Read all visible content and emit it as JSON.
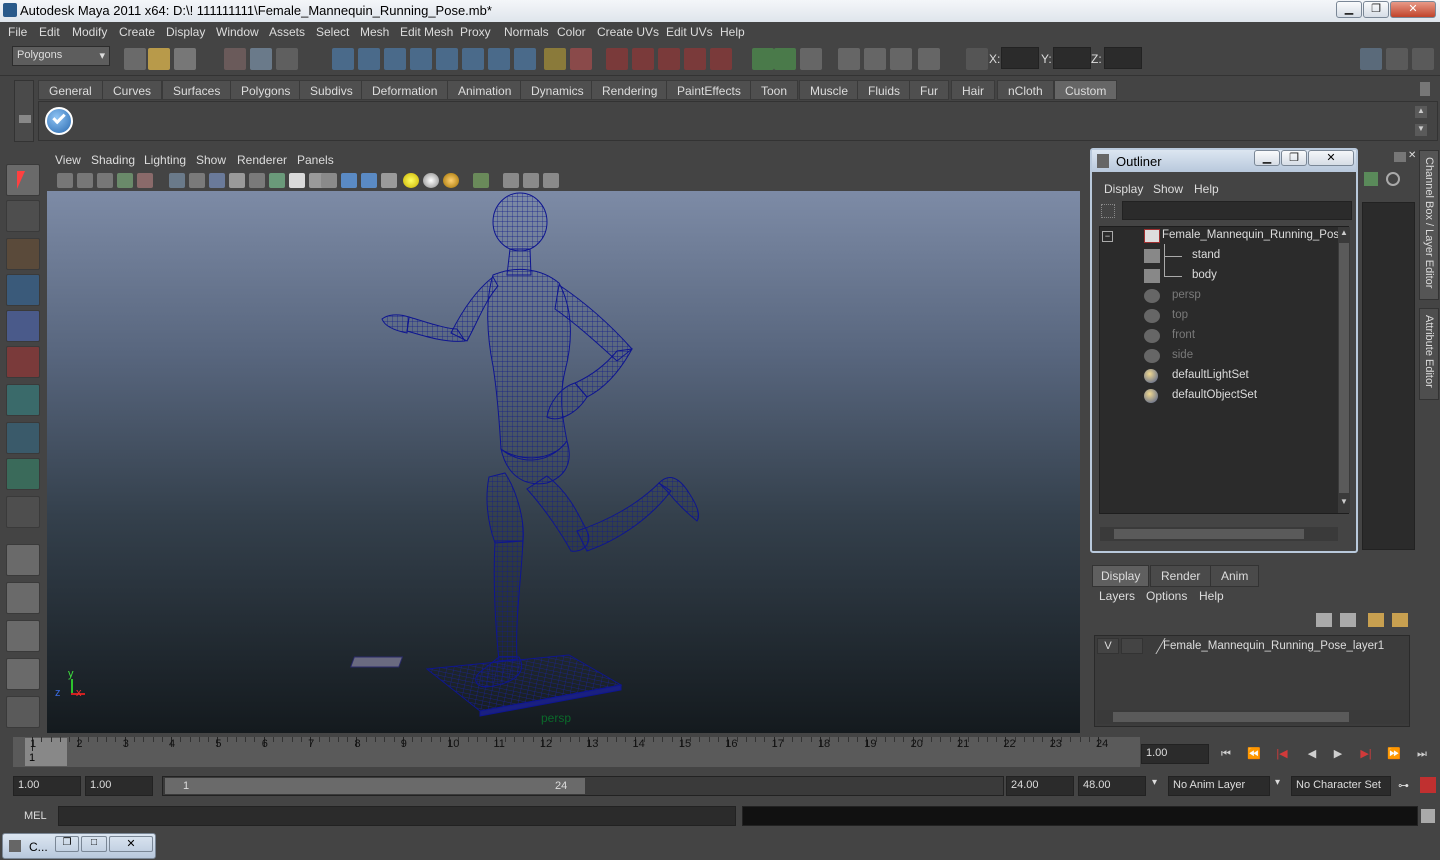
{
  "window": {
    "title": "Autodesk Maya 2011 x64: D:\\! 111111111\\Female_Mannequin_Running_Pose.mb*"
  },
  "menubar": [
    "File",
    "Edit",
    "Modify",
    "Create",
    "Display",
    "Window",
    "Assets",
    "Select",
    "Mesh",
    "Edit Mesh",
    "Proxy",
    "Normals",
    "Color",
    "Create UVs",
    "Edit UVs",
    "Help"
  ],
  "toolbar": {
    "mode": "Polygons",
    "x_label": "X:",
    "y_label": "Y:",
    "z_label": "Z:"
  },
  "shelf_tabs": [
    "General",
    "Curves",
    "Surfaces",
    "Polygons",
    "Subdivs",
    "Deformation",
    "Animation",
    "Dynamics",
    "Rendering",
    "PaintEffects",
    "Toon",
    "Muscle",
    "Fluids",
    "Fur",
    "Hair",
    "nCloth",
    "Custom"
  ],
  "shelf_active": "Custom",
  "viewport": {
    "menus": [
      "View",
      "Shading",
      "Lighting",
      "Show",
      "Renderer",
      "Panels"
    ],
    "camera_label": "persp",
    "axis_y": "y",
    "axis_z": "z",
    "axis_x": "x"
  },
  "outliner": {
    "title": "Outliner",
    "menus": [
      "Display",
      "Show",
      "Help"
    ],
    "expand_symbol": "−",
    "items": [
      "Female_Mannequin_Running_Pose",
      "stand",
      "body",
      "persp",
      "top",
      "front",
      "side",
      "defaultLightSet",
      "defaultObjectSet"
    ]
  },
  "side_tabs": {
    "channel_box": "Channel Box / Layer Editor",
    "attribute_editor": "Attribute Editor"
  },
  "layer_editor": {
    "tabs": [
      "Display",
      "Render",
      "Anim"
    ],
    "menus": [
      "Layers",
      "Options",
      "Help"
    ],
    "layer_visibility": "V",
    "layer_name": "Female_Mannequin_Running_Pose_layer1"
  },
  "timeline": {
    "ticks": [
      "1",
      "2",
      "3",
      "4",
      "5",
      "6",
      "7",
      "8",
      "9",
      "10",
      "11",
      "12",
      "13",
      "14",
      "15",
      "16",
      "17",
      "18",
      "19",
      "20",
      "21",
      "22",
      "23",
      "24"
    ],
    "current_frame": "1",
    "current_time": "1.00"
  },
  "range": {
    "start_time": "1.00",
    "start_playback": "1.00",
    "slider_start": "1",
    "slider_end": "24",
    "end_playback": "24.00",
    "end_time": "48.00",
    "anim_layer": "No Anim Layer",
    "character_set": "No Character Set"
  },
  "command_line": {
    "label": "MEL"
  },
  "taskbar": {
    "label": "C..."
  }
}
